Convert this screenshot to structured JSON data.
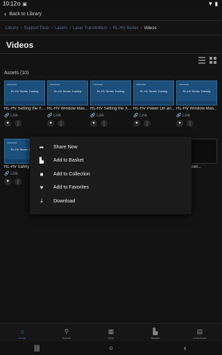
{
  "status_bar": {
    "time": "10:12",
    "left_icons": [
      "gear-icon",
      "clipboard-icon"
    ],
    "right_icons": [
      "wifi-icon",
      "battery-icon"
    ]
  },
  "header": {
    "back_label": "Back to Library"
  },
  "breadcrumbs": [
    {
      "label": "Library",
      "current": false
    },
    {
      "label": "Support Tools",
      "current": false
    },
    {
      "label": "Lasers",
      "current": false
    },
    {
      "label": "Laser Transmitters",
      "current": false
    },
    {
      "label": "RL-HV Series",
      "current": false
    },
    {
      "label": "Videos",
      "current": true
    }
  ],
  "page": {
    "title": "Videos",
    "assets_label": "Assets (10)"
  },
  "cards": [
    {
      "name": "RL-HV Setting the Y...",
      "link": "Link",
      "thumb_brand": "TOPCON",
      "thumb_caption": "RL-HV Series Training"
    },
    {
      "name": "RL-HV Window Mas...",
      "link": "Link",
      "thumb_brand": "TOPCON",
      "thumb_caption": "RL-HV Series Training"
    },
    {
      "name": "RL-HV Setting the X...",
      "link": "Link",
      "thumb_brand": "TOPCON",
      "thumb_caption": "RL-HV Series Training"
    },
    {
      "name": "RL-HV Power On an...",
      "link": "Link",
      "thumb_brand": "TOPCON",
      "thumb_caption": "RL-HV Series Training"
    },
    {
      "name": "RL-HV Window Mas...",
      "link": "Link",
      "thumb_brand": "TOPCON",
      "thumb_caption": "RL-HV Series Training"
    },
    {
      "name": "RL-HV Safety I",
      "link": "Link",
      "thumb_brand": "TOPCON",
      "thumb_caption": "RL-HV Series Training"
    },
    {
      "name": "oping Laser...",
      "link": "",
      "thumb_brand": "",
      "thumb_caption": ""
    }
  ],
  "context_menu": [
    {
      "label": "Share Now",
      "icon": "share-icon"
    },
    {
      "label": "Add to Basket",
      "icon": "basket-icon"
    },
    {
      "label": "Add to Collection",
      "icon": "collection-icon"
    },
    {
      "label": "Add to Favorites",
      "icon": "heart-icon"
    },
    {
      "label": "Download",
      "icon": "download-icon"
    }
  ],
  "tabs": [
    {
      "label": "Home",
      "icon": "home-icon",
      "active": true
    },
    {
      "label": "Search",
      "icon": "search-icon",
      "active": false
    },
    {
      "label": "DAM",
      "icon": "dam-icon",
      "active": false
    },
    {
      "label": "Basket",
      "icon": "basket-icon",
      "active": false
    },
    {
      "label": "Collections",
      "icon": "collections-icon",
      "active": false
    }
  ],
  "colors": {
    "background": "#131313",
    "accent": "#3b6fe0",
    "breadcrumb_link": "#5c6e9a",
    "thumb_blue": "#1c4f7a"
  }
}
